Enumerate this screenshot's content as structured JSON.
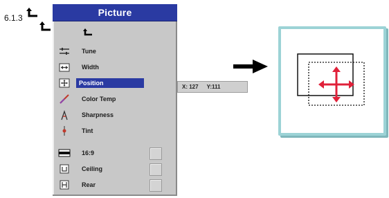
{
  "section_number": "6.1.3",
  "menu": {
    "title": "Picture",
    "items": [
      {
        "label": "Tune",
        "icon": "tune-icon",
        "selected": false,
        "checkbox": false
      },
      {
        "label": "Width",
        "icon": "width-icon",
        "selected": false,
        "checkbox": false
      },
      {
        "label": "Position",
        "icon": "position-icon",
        "selected": true,
        "checkbox": false
      },
      {
        "label": "Color Temp",
        "icon": "color-temp-icon",
        "selected": false,
        "checkbox": false
      },
      {
        "label": "Sharpness",
        "icon": "sharpness-icon",
        "selected": false,
        "checkbox": false
      },
      {
        "label": "Tint",
        "icon": "tint-icon",
        "selected": false,
        "checkbox": false
      },
      {
        "label": "16:9",
        "icon": "aspect-16-9-icon",
        "selected": false,
        "checkbox": true
      },
      {
        "label": "Ceiling",
        "icon": "ceiling-icon",
        "selected": false,
        "checkbox": true
      },
      {
        "label": "Rear",
        "icon": "rear-icon",
        "selected": false,
        "checkbox": true
      }
    ]
  },
  "readout": {
    "x_text": "X: 127",
    "y_text": "Y:111"
  },
  "colors": {
    "menu_header": "#2a3aa2",
    "menu_bg": "#c8c8c8",
    "screen_border": "#9cd3d6",
    "move_arrows": "#e0213a"
  }
}
